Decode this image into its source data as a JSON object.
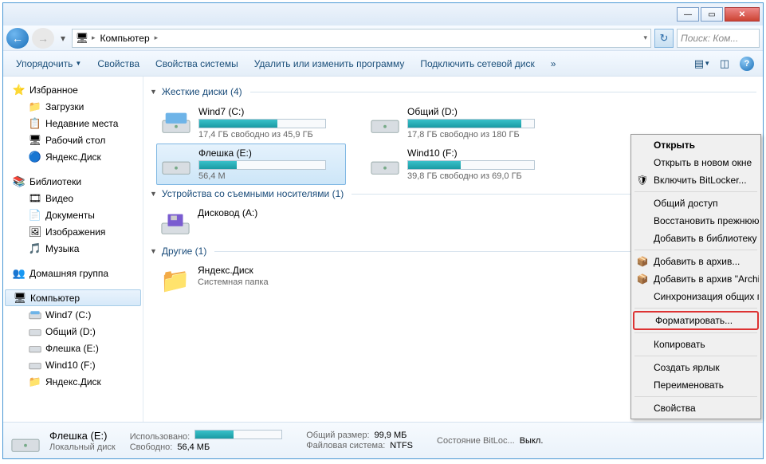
{
  "titlebar": {
    "min": "—",
    "max": "▭",
    "close": "✕"
  },
  "nav": {
    "computer_icon": "🖥",
    "location": "Компьютер",
    "search_placeholder": "Поиск: Ком..."
  },
  "toolbar": {
    "organize": "Упорядочить",
    "properties": "Свойства",
    "sysprops": "Свойства системы",
    "uninstall": "Удалить или изменить программу",
    "mapdrive": "Подключить сетевой диск",
    "more": "»"
  },
  "sidebar": {
    "fav": "Избранное",
    "downloads": "Загрузки",
    "recent": "Недавние места",
    "desktop": "Рабочий стол",
    "yadisk": "Яндекс.Диск",
    "libs": "Библиотеки",
    "videos": "Видео",
    "docs": "Документы",
    "pictures": "Изображения",
    "music": "Музыка",
    "homegroup": "Домашняя группа",
    "computer": "Компьютер",
    "d_wind7": "Wind7 (C:)",
    "d_obsh": "Общий (D:)",
    "d_flash": "Флешка (E:)",
    "d_wind10": "Wind10 (F:)",
    "d_yadisk": "Яндекс.Диск"
  },
  "sections": {
    "hdd": "Жесткие диски (4)",
    "removable": "Устройства со съемными носителями (1)",
    "other": "Другие (1)"
  },
  "drives": {
    "c": {
      "name": "Wind7 (C:)",
      "free": "17,4 ГБ свободно из 45,9 ГБ",
      "fill": 62
    },
    "d": {
      "name": "Общий (D:)",
      "free": "17,8 ГБ свободно из 180 ГБ",
      "fill": 90
    },
    "e": {
      "name": "Флешка (E:)",
      "free": "56,4 М",
      "fill": 30
    },
    "f": {
      "name": "Wind10 (F:)",
      "free": "39,8 ГБ свободно из 69,0 ГБ",
      "fill": 42
    },
    "a": {
      "name": "Дисковод (A:)"
    },
    "ya": {
      "name": "Яндекс.Диск",
      "sub": "Системная папка"
    }
  },
  "ctx": {
    "open": "Открыть",
    "open_new": "Открыть в новом окне",
    "bitlocker": "Включить BitLocker...",
    "share": "Общий доступ",
    "restore": "Восстановить прежнюю",
    "addlib": "Добавить в библиотеку",
    "addarc": "Добавить в архив...",
    "addarc2": "Добавить в архив \"Archiv",
    "sync": "Синхронизация общих п",
    "format": "Форматировать...",
    "copy": "Копировать",
    "shortcut": "Создать ярлык",
    "rename": "Переименовать",
    "props": "Свойства"
  },
  "status": {
    "name": "Флешка (E:)",
    "type": "Локальный диск",
    "used_lbl": "Использовано:",
    "free_lbl": "Свободно:",
    "free_val": "56,4 МБ",
    "size_lbl": "Общий размер:",
    "size_val": "99,9 МБ",
    "fs_lbl": "Файловая система:",
    "fs_val": "NTFS",
    "bl_lbl": "Состояние BitLoc...",
    "bl_val": "Выкл."
  }
}
